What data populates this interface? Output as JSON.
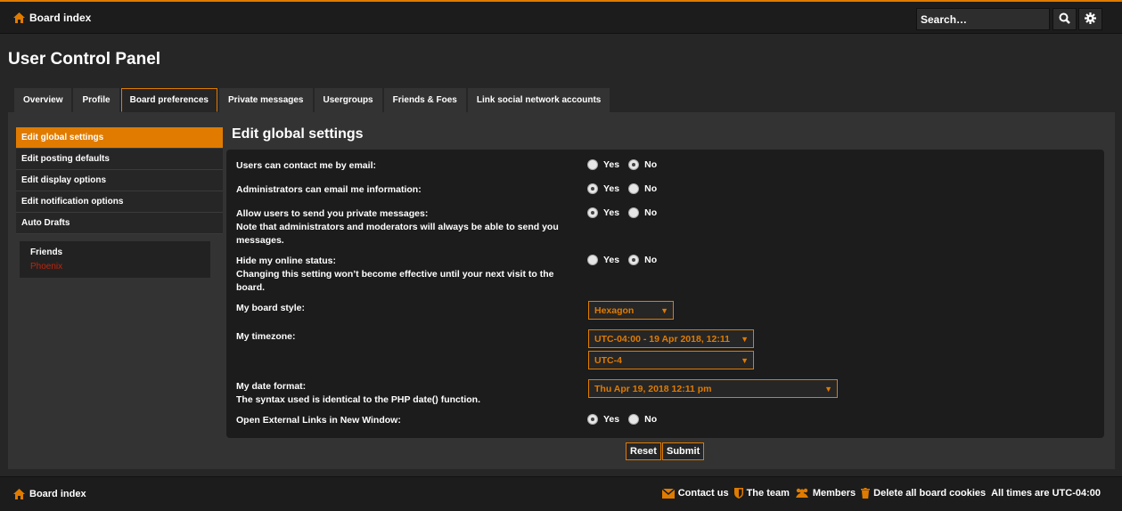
{
  "header": {
    "board_index": "Board index",
    "search_placeholder": "Search…",
    "accent_color": "#e07b00"
  },
  "page": {
    "title": "User Control Panel"
  },
  "tabs": [
    {
      "label": "Overview",
      "active": false
    },
    {
      "label": "Profile",
      "active": false
    },
    {
      "label": "Board preferences",
      "active": true
    },
    {
      "label": "Private messages",
      "active": false
    },
    {
      "label": "Usergroups",
      "active": false
    },
    {
      "label": "Friends & Foes",
      "active": false
    },
    {
      "label": "Link social network accounts",
      "active": false
    }
  ],
  "sidebar": {
    "items": [
      {
        "label": "Edit global settings",
        "active": true
      },
      {
        "label": "Edit posting defaults",
        "active": false
      },
      {
        "label": "Edit display options",
        "active": false
      },
      {
        "label": "Edit notification options",
        "active": false
      },
      {
        "label": "Auto Drafts",
        "active": false
      }
    ],
    "friends_title": "Friends",
    "friends": [
      "Phoenix"
    ]
  },
  "main": {
    "title": "Edit global settings",
    "yes": "Yes",
    "no": "No",
    "fields": {
      "contact_email": {
        "label": "Users can contact me by email:",
        "value": "No"
      },
      "admin_email": {
        "label": "Administrators can email me information:",
        "value": "Yes"
      },
      "allow_pm": {
        "label": "Allow users to send you private messages:",
        "note": "Note that administrators and moderators will always be able to send you messages.",
        "value": "Yes"
      },
      "hide_online": {
        "label": "Hide my online status:",
        "note": "Changing this setting won’t become effective until your next visit to the board.",
        "value": "No"
      },
      "board_style": {
        "label": "My board style:",
        "value": "Hexagon"
      },
      "timezone": {
        "label": "My timezone:",
        "value_date": "UTC-04:00 - 19 Apr 2018, 12:11",
        "value_zone": "UTC-4"
      },
      "date_format": {
        "label": "My date format:",
        "note": "The syntax used is identical to the PHP date() function.",
        "value": "Thu Apr 19, 2018 12:11 pm"
      },
      "external_links": {
        "label": "Open External Links in New Window:",
        "value": "Yes"
      }
    },
    "reset_label": "Reset",
    "submit_label": "Submit"
  },
  "footer": {
    "board_index": "Board index",
    "contact": "Contact us",
    "team": "The team",
    "members": "Members",
    "delete_cookies": "Delete all board cookies",
    "timezone_note": "All times are UTC-04:00"
  }
}
